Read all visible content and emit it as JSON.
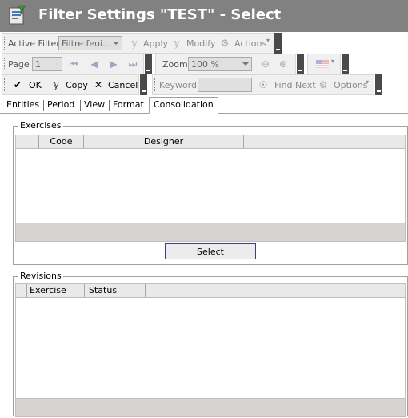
{
  "window": {
    "title": "Filter Settings \"TEST\" - Select",
    "icon": "app-filter-icon"
  },
  "toolbar1": {
    "active_filter_label": "Active Filter",
    "active_filter_value": "Filtre feui...",
    "apply_label": "Apply",
    "modify_label": "Modify",
    "actions_label": "Actions"
  },
  "toolbar2": {
    "page_label": "Page",
    "page_value": "1",
    "zoom_label": "Zoom",
    "zoom_value": "100 %"
  },
  "toolbar3": {
    "ok_label": "OK",
    "copy_label": "Copy",
    "cancel_label": "Cancel",
    "keyword_label": "Keyword",
    "keyword_value": "",
    "find_next_label": "Find Next",
    "options_label": "Options"
  },
  "tabs": [
    "Entities",
    "Period",
    "View",
    "Format",
    "Consolidation"
  ],
  "active_tab": "Consolidation",
  "exercises": {
    "legend": "Exercises",
    "columns": [
      "Code",
      "Designer"
    ],
    "select_label": "Select"
  },
  "revisions": {
    "legend": "Revisions",
    "columns": [
      "Exercise",
      "Status"
    ]
  },
  "colors": {
    "titlebar": "#818181",
    "toolbar": "#f0f0f0",
    "grid_footer": "#d7d3d1",
    "overflow": "#4a4a4a"
  }
}
